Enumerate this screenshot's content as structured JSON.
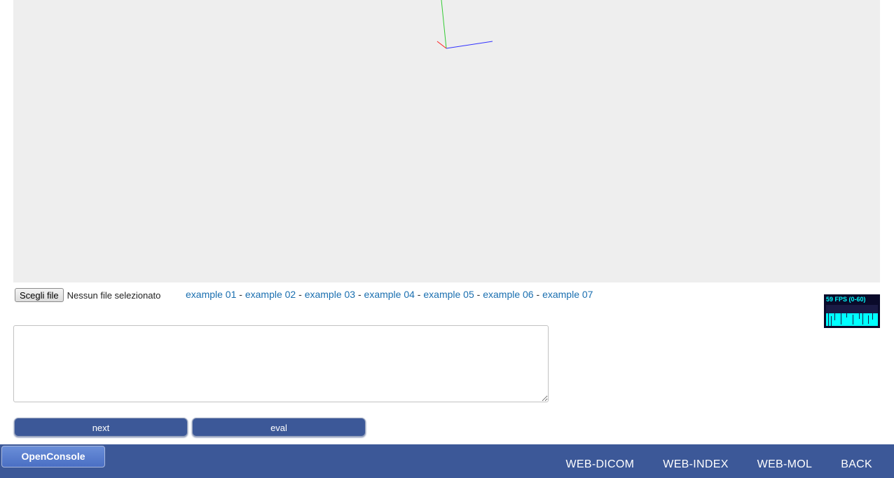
{
  "file_input": {
    "button_label": "Scegli file",
    "status": "Nessun file selezionato"
  },
  "examples": [
    {
      "label": "example 01"
    },
    {
      "label": "example 02"
    },
    {
      "label": "example 03"
    },
    {
      "label": "example 04"
    },
    {
      "label": "example 05"
    },
    {
      "label": "example 06"
    },
    {
      "label": "example 07"
    }
  ],
  "examples_separator": " - ",
  "fps_meter": {
    "label": "59 FPS (0-60)",
    "color": "#00ffff"
  },
  "editor": {
    "value": ""
  },
  "buttons": {
    "next_label": "next",
    "eval_label": "eval"
  },
  "bottom_bar": {
    "console_label": "OpenConsole",
    "nav": [
      {
        "label": "WEB-DICOM"
      },
      {
        "label": "WEB-INDEX"
      },
      {
        "label": "WEB-MOL"
      },
      {
        "label": "BACK"
      }
    ],
    "color": "#3c5898"
  },
  "viewport": {
    "background": "#eeeeee",
    "axis_colors": {
      "x": "#ff0000",
      "y": "#00cc00",
      "z": "#0000ff"
    }
  }
}
